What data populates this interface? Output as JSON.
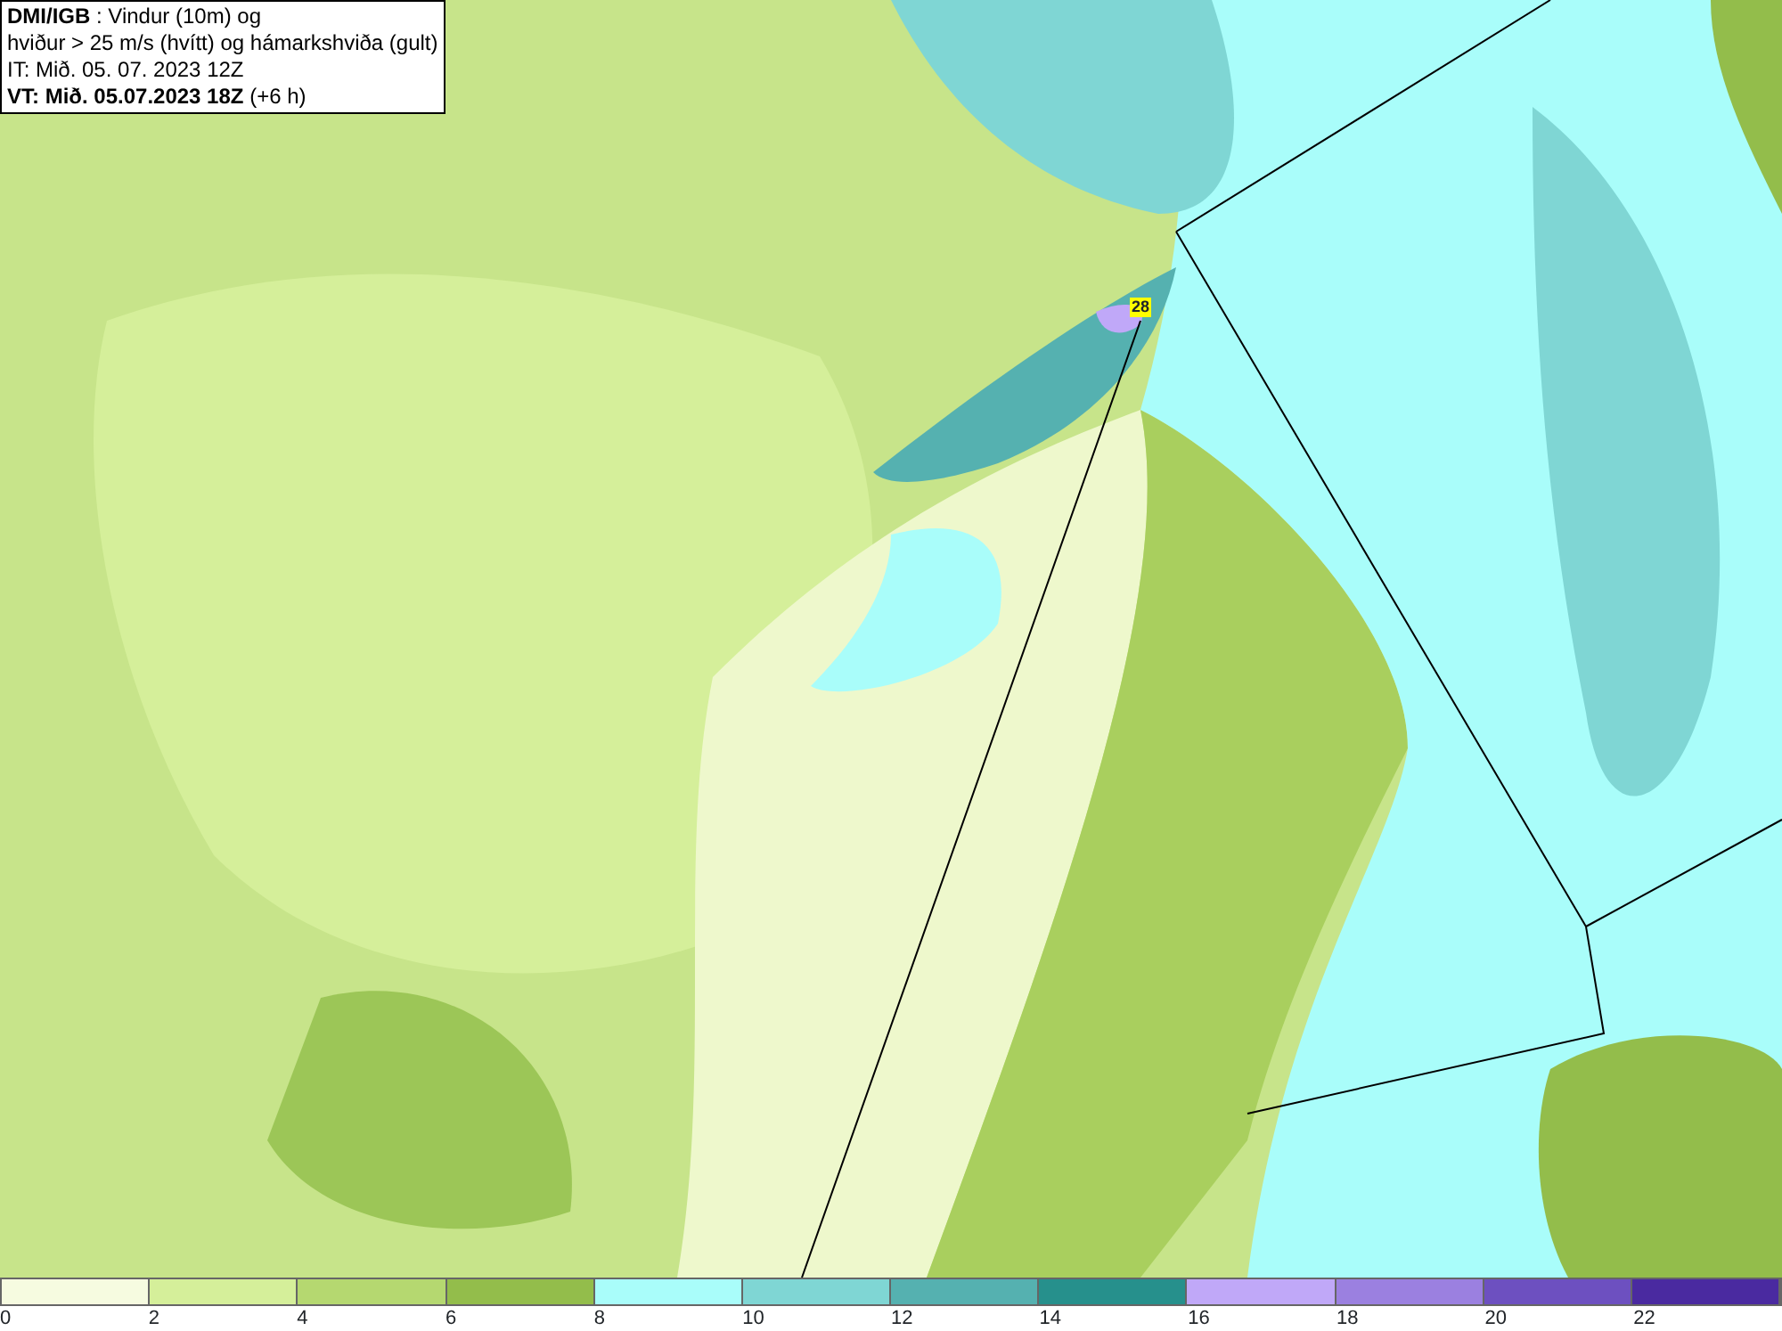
{
  "title_box": {
    "lines": [
      "**DMI/IGB** : Vindur (10m) og",
      "hviður > 25 m/s (hvítt) og hámarkshviða (gult)",
      "IT: Mið. 05. 07. 2023 12Z",
      "**VT: Mið. 05.07.2023 18Z** (+6 h)"
    ]
  },
  "map": {
    "gust_labels": [
      {
        "text": "28"
      }
    ]
  },
  "legend": {
    "bins": [
      {
        "color": "#f6fbe0"
      },
      {
        "color": "#d5ef9a"
      },
      {
        "color": "#b5d870"
      },
      {
        "color": "#93bd4b"
      },
      {
        "color": "#a9fdfa"
      },
      {
        "color": "#7fd6d4"
      },
      {
        "color": "#55b1b0"
      },
      {
        "color": "#26908c"
      },
      {
        "color": "#c0a8f8"
      },
      {
        "color": "#9b80e0"
      },
      {
        "color": "#6d50c0"
      },
      {
        "color": "#4a2aa0"
      }
    ],
    "ticks": [
      "0",
      "2",
      "4",
      "6",
      "8",
      "10",
      "12",
      "14",
      "16",
      "18",
      "20",
      "22"
    ]
  }
}
